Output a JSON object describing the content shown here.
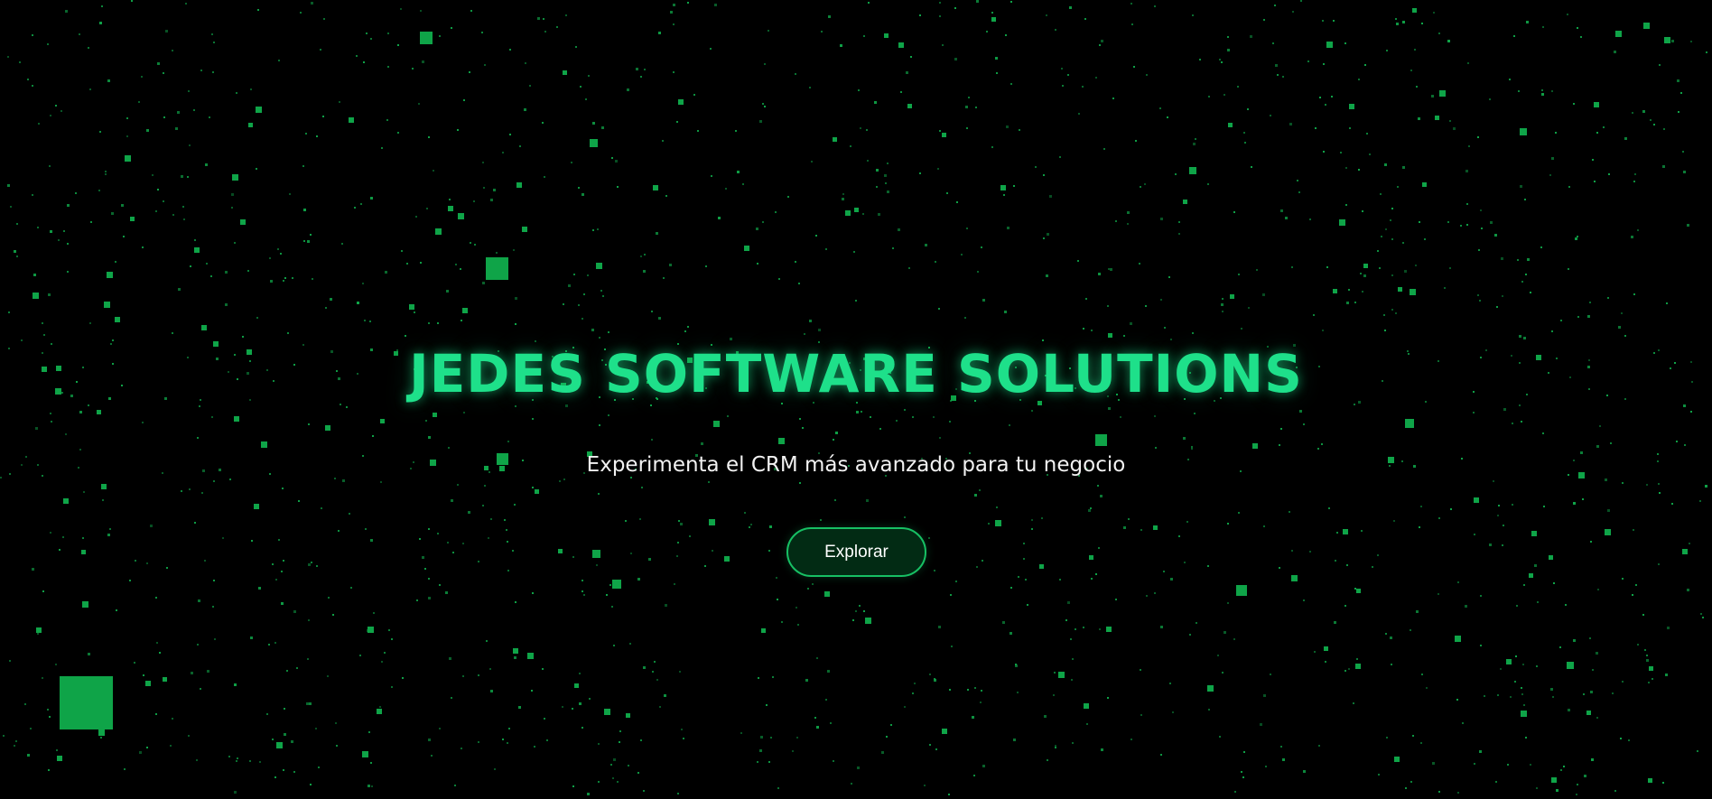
{
  "hero": {
    "title": "JEDES SOFTWARE SOLUTIONS",
    "subtitle": "Experimenta el CRM más avanzado para tu negocio",
    "cta_label": "Explorar"
  },
  "theme": {
    "background": "#000000",
    "accent": "#1ee08a",
    "particle": "#0fa448",
    "button_fill": "#022b14",
    "button_border": "#17c064"
  }
}
